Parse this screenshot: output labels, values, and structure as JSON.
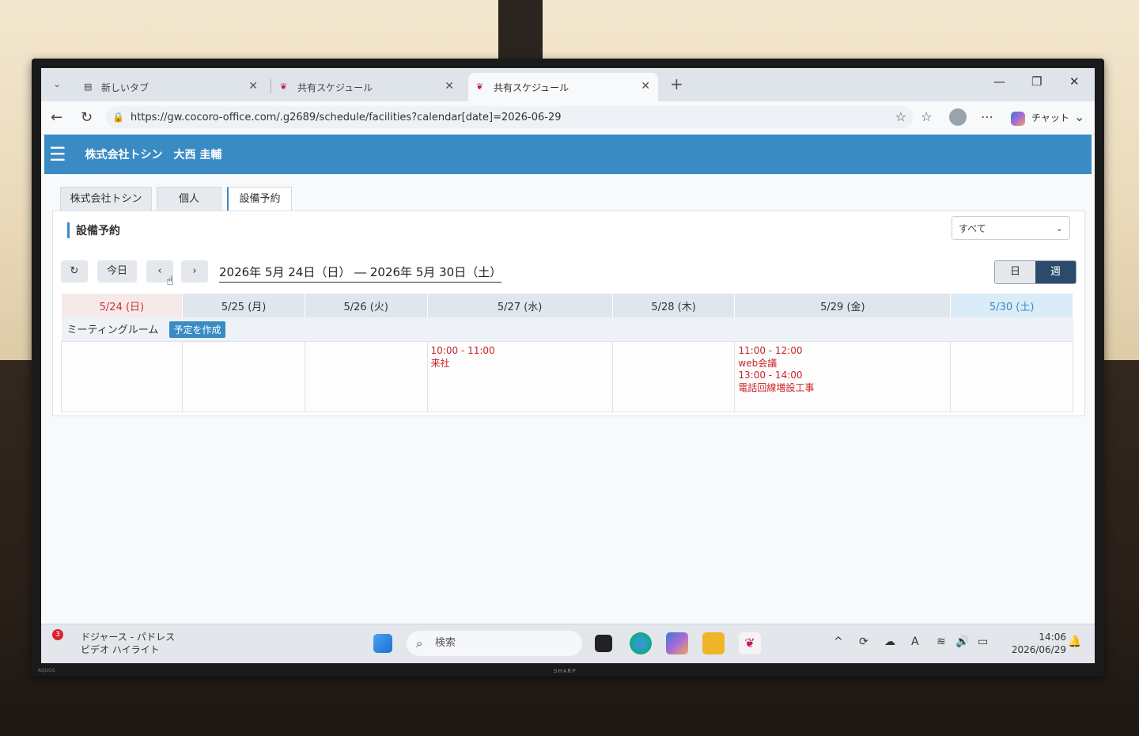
{
  "browser": {
    "tabs": [
      {
        "label": "新しいタブ",
        "active": false
      },
      {
        "label": "共有スケジュール",
        "active": false
      },
      {
        "label": "共有スケジュール",
        "active": true
      }
    ],
    "new_tab_label": "+",
    "url": "https://gw.cocoro-office.com/.g2689/schedule/facilities?calendar[date]=2026-06-29",
    "copilot_label": "チャット"
  },
  "app": {
    "company": "株式会社トシン",
    "user": "大西 圭輔",
    "nav_tabs": [
      {
        "label": "株式会社トシン"
      },
      {
        "label": "個人"
      },
      {
        "label": "設備予約"
      }
    ],
    "section_title": "設備予約",
    "filter_select": "すべて",
    "toolbar": {
      "refresh": "↻",
      "today": "今日",
      "prev": "‹",
      "next": "›",
      "date_range": "2026年 5月 24日（日） ― 2026年 5月 30日（土）",
      "view_day": "日",
      "view_week": "週"
    },
    "calendar": {
      "days": [
        "5/24 (日)",
        "5/25 (月)",
        "5/26 (火)",
        "5/27 (水)",
        "5/28 (木)",
        "5/29 (金)",
        "5/30 (土)"
      ],
      "room": "ミーティングルーム",
      "create_label": "予定を作成",
      "events": {
        "d3": [
          {
            "time": "10:00 - 11:00",
            "title": "来社"
          }
        ],
        "d5": [
          {
            "time": "11:00 - 12:00",
            "title": "web会議"
          },
          {
            "time": "13:00 - 14:00",
            "title": "電話回線増設工事"
          }
        ]
      }
    }
  },
  "taskbar": {
    "news_badge": "3",
    "news_line1": "ドジャース - パドレス",
    "news_line2": "ビデオ ハイライト",
    "search_placeholder": "検索",
    "time": "14:06",
    "date": "2026/06/29"
  },
  "tv": {
    "brand": "SHARP",
    "model": "AQUOS"
  },
  "colors": {
    "accent": "#3a8bc4",
    "event": "#cc2222",
    "sunday": "#cc3333",
    "saturday": "#3a8bc4"
  }
}
